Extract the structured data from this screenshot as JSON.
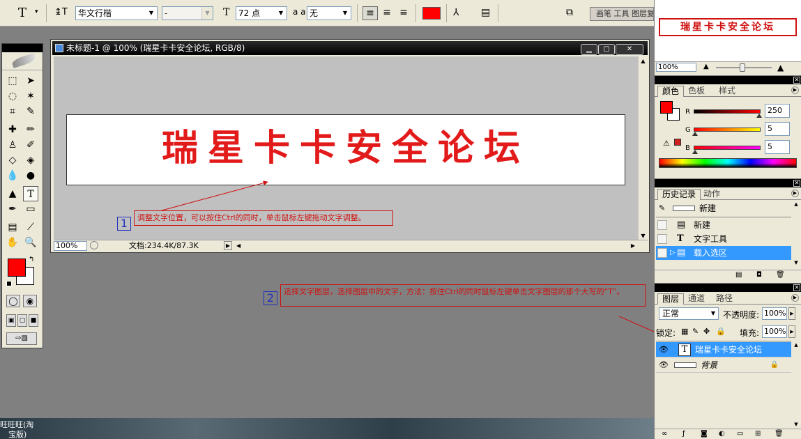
{
  "options_bar": {
    "font_family": "华文行楷",
    "font_style": "-",
    "font_size": "72 点",
    "antialias_label": "a a",
    "antialias": "无",
    "text_color": "#ff0000",
    "palette_tab": "画笔 工具 图层复"
  },
  "document": {
    "title": "未标题-1 @ 100% (瑞星卡卡安全论坛, RGB/8)",
    "canvas_text": "瑞星卡卡安全论坛",
    "zoom": "100%",
    "doc_info": "文档:234.4K/87.3K"
  },
  "annotations": [
    {
      "number": "1",
      "text": "调整文字位置，可以按住Ctrl的同时，单击鼠标左键拖动文字调整。"
    },
    {
      "number": "2",
      "text": "选择文字图层，选择图层中的文字，方法：按住Ctrl的同时鼠标左键单击文字图层的那个大写的“T”。"
    }
  ],
  "navigator": {
    "preview_text": "瑞星卡卡安全论坛",
    "zoom": "100%"
  },
  "color_panel": {
    "tabs": [
      "颜色",
      "色板",
      "样式"
    ],
    "r_label": "R",
    "g_label": "G",
    "b_label": "B",
    "r": "250",
    "g": "5",
    "b": "5",
    "r_fraction": 0.98,
    "g_fraction": 0.02,
    "b_fraction": 0.02,
    "foreground": "#ff0000",
    "background": "#ffffff"
  },
  "history_panel": {
    "tabs": [
      "历史记录",
      "动作"
    ],
    "snapshot": "新建",
    "items": [
      "新建",
      "文字工具",
      "载入选区"
    ]
  },
  "layers_panel": {
    "tabs": [
      "图层",
      "通道",
      "路径"
    ],
    "blend_mode": "正常",
    "opacity_label": "不透明度:",
    "opacity": "100%",
    "lock_label": "锁定:",
    "fill_label": "填充:",
    "fill": "100%",
    "layers": [
      {
        "name": "瑞星卡卡安全论坛",
        "type": "T"
      },
      {
        "name": "背景",
        "locked": true
      }
    ]
  },
  "desktop": {
    "label_line1": "旺旺旺(淘",
    "label_line2": "宝版)"
  }
}
